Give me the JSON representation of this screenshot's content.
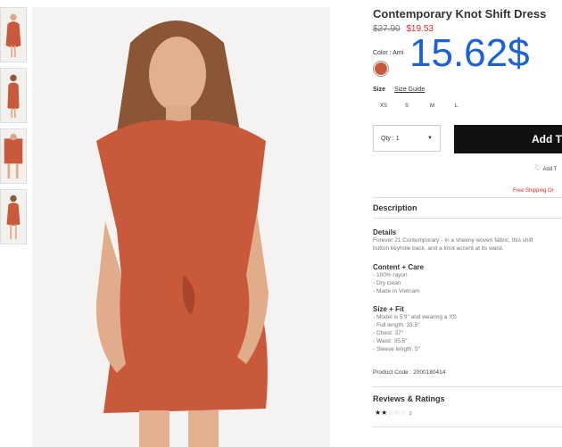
{
  "product": {
    "title": "Contemporary Knot Shift Dress",
    "old_price": "$27.90",
    "sale_price": "$19.53",
    "promo_price": "15.62$",
    "color_label": "Color : Ami",
    "swatch_color": "#c8593b",
    "size_label": "Size",
    "size_guide": "Size Guide",
    "sizes": [
      "XS",
      "S",
      "M",
      "L"
    ],
    "qty_label": "Qty : 1",
    "add_button": "Add T",
    "add_wishlist": "Add T",
    "free_shipping": "Free Shipping Or"
  },
  "description": {
    "heading": "Description",
    "details_heading": "Details",
    "details_text_1": "Forever 21 Contemporary - In a sheeny woven fabric, this shift",
    "details_text_2": "button keyhole back, and a knot accent at its waist.",
    "care_heading": "Content + Care",
    "care_items": [
      "- 100% rayon",
      "- Dry clean",
      "- Made in Vietnam"
    ],
    "fit_heading": "Size + Fit",
    "fit_items": [
      "- Model is 5'9\" and wearing a XS",
      "- Full length: 33.5\"",
      "- Chest: 37\"",
      "- Waist: 35.5\"",
      "- Sleeve length: 5\""
    ],
    "product_code": "Product Code : 2000180414"
  },
  "reviews": {
    "heading": "Reviews & Ratings",
    "rating": 2,
    "max": 5,
    "count": "2"
  },
  "icons": {
    "wishlist": "heart-icon",
    "qty": "chevron-down-icon",
    "star": "star-icon"
  }
}
